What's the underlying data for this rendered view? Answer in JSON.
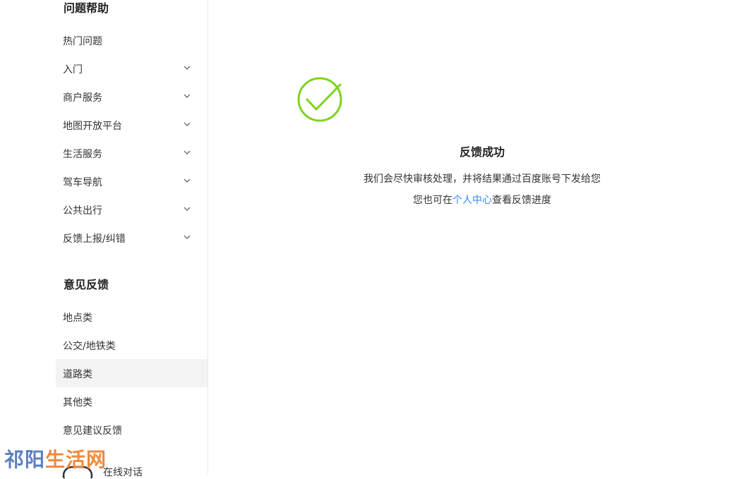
{
  "sidebar": {
    "help_title": "问题帮助",
    "help_items": [
      {
        "label": "热门问题",
        "has_chevron": false
      },
      {
        "label": "入门",
        "has_chevron": true
      },
      {
        "label": "商户服务",
        "has_chevron": true
      },
      {
        "label": "地图开放平台",
        "has_chevron": true
      },
      {
        "label": "生活服务",
        "has_chevron": true
      },
      {
        "label": "驾车导航",
        "has_chevron": true
      },
      {
        "label": "公共出行",
        "has_chevron": true
      },
      {
        "label": "反馈上报/纠错",
        "has_chevron": true
      }
    ],
    "feedback_title": "意见反馈",
    "feedback_items": [
      {
        "label": "地点类"
      },
      {
        "label": "公交/地铁类"
      },
      {
        "label": "道路类",
        "active": true
      },
      {
        "label": "其他类"
      },
      {
        "label": "意见建议反馈"
      }
    ],
    "chat_label": "在线对话"
  },
  "result": {
    "title": "反馈成功",
    "line1": "我们会尽快审核处理，并将结果通过百度账号下发给您",
    "line2_prefix": "您也可在",
    "line2_link": "个人中心",
    "line2_suffix": "查看反馈进度",
    "check_color": "#7ed321"
  },
  "watermark": {
    "part1": "祁阳",
    "part2": "生活网"
  },
  "colors": {
    "link": "#3385ff",
    "active_bg": "#f3f3f3",
    "divider": "#e8e8e8"
  }
}
